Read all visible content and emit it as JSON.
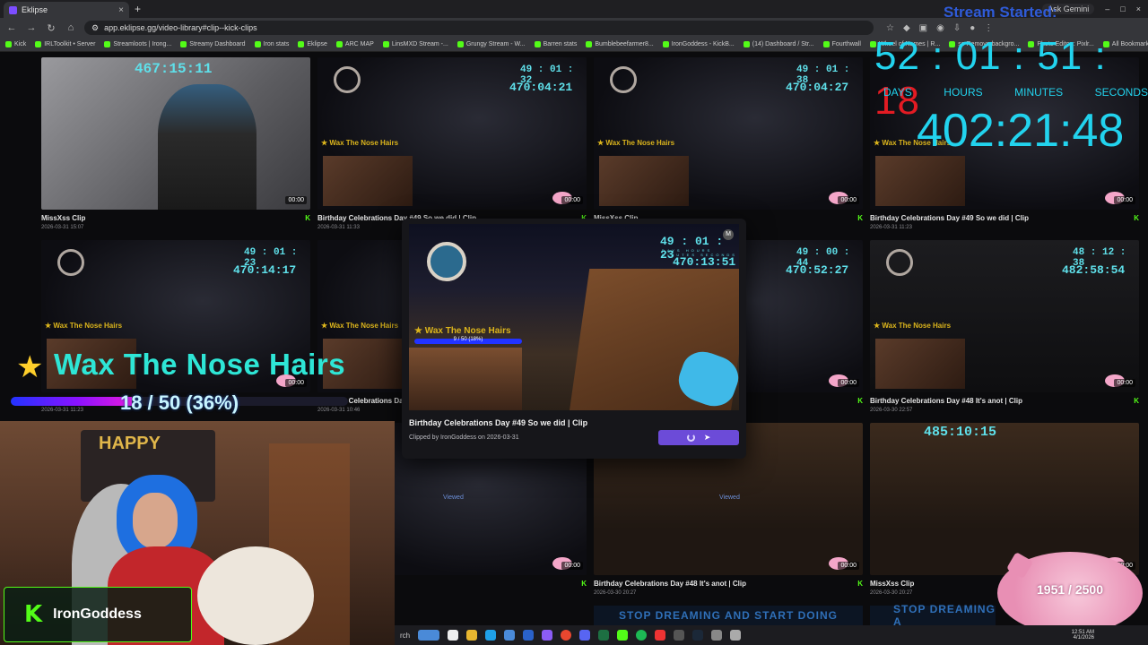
{
  "browser": {
    "tab_title": "Eklipse",
    "tab_close": "×",
    "new_tab": "+",
    "right_items": [
      "Ask Gemini",
      "–",
      "□",
      "×"
    ],
    "url": "app.eklipse.gg/video-library#clip--kick-clips",
    "bookmarks": [
      "Kick",
      "IRLToolkit • Server",
      "Streamloots | Irong...",
      "Streamy Dashboard",
      "Iron stats",
      "Eklipse",
      "ARC MAP",
      "LinsMXD Stream -...",
      "Grungy Stream - W...",
      "Barren stats",
      "Bumblebeefarmer8...",
      "IronGoddess - KickB...",
      "(14) Dashboard / Str...",
      "Fourthwall",
      "Wheel of Names | R...",
      "se Remove backgro...",
      "Photo Editor : Pixlr...",
      "All Bookmarks"
    ]
  },
  "stream_timer": {
    "label": "Stream Started:",
    "days": "52",
    "hours": "01",
    "minutes": "51",
    "seconds": "18",
    "sep": ":",
    "unit_days": "DAYS",
    "unit_hours": "HOURS",
    "unit_minutes": "MINUTES",
    "unit_seconds": "SECONDS",
    "total": "402:21:48"
  },
  "goal": {
    "star": "★",
    "title": "Wax The Nose Hairs",
    "progress_text": "18 / 50 (36%)",
    "fraction": 0.36
  },
  "streamer": {
    "kick_logo": "K",
    "name": "IronGoddess",
    "banner_text": "HAPPY"
  },
  "clips": [
    {
      "title": "MissXss Clip",
      "date": "2026-03-31 15:07",
      "timer": "467:15:11",
      "duration": "00:00"
    },
    {
      "title": "Birthday Celebrations Day #49 So we did | Clip",
      "date": "2026-03-31 11:33",
      "timer": "470:04:21",
      "timer_top": "49 : 01 : 32",
      "wax": "Wax The Nose Hairs",
      "duration": "00:00"
    },
    {
      "title": "MissXss Clip",
      "date": "",
      "timer": "470:04:27",
      "timer_top": "49 : 01 : 38",
      "wax": "Wax The Nose Hairs",
      "duration": "00:00"
    },
    {
      "title": "Birthday Celebrations Day #49 So we did | Clip",
      "date": "2026-03-31 11:23",
      "timer": "",
      "wax": "Wax The Nose Hairs",
      "duration": "00:00"
    },
    {
      "title": "",
      "date": "2026-03-31 11:23",
      "timer": "470:14:17",
      "timer_top": "49 : 01 : 23",
      "wax": "Wax The Nose Hairs",
      "duration": "00:00"
    },
    {
      "title": "Birthday Celebrations Day",
      "date": "2026-03-31 10:46",
      "timer": "",
      "wax": "Wax The Nose Hairs",
      "duration": "00:00"
    },
    {
      "title": "",
      "date": "",
      "timer": "470:52:27",
      "timer_top": "49 : 00 : 44",
      "duration": "00:00"
    },
    {
      "title": "Birthday Celebrations Day #48 It's anot | Clip",
      "date": "2026-03-30 22:57",
      "timer": "482:58:54",
      "timer_top": "48 : 12 : 38",
      "wax": "Wax The Nose Hairs",
      "duration": "00:00"
    },
    {
      "title": "",
      "date": "",
      "timer": "",
      "viewed": "Viewed",
      "duration": "00:00"
    },
    {
      "title": "Birthday Celebrations Day #48 It's anot | Clip",
      "date": "2026-03-30 20:27",
      "timer": "",
      "viewed": "Viewed",
      "duration": "00:00"
    },
    {
      "title": "MissXss Clip",
      "date": "2026-03-30 20:27",
      "timer": "485:10:15",
      "duration": "00:00"
    }
  ],
  "preview": {
    "timer_top": "49 : 01 : 23",
    "units": "DAYS HOURS MINUTES SECONDS",
    "timer": "470:13:51",
    "wax": "Wax The Nose Hairs",
    "wax_progress": "9 / 50 (18%)",
    "title": "Birthday Celebrations Day #49 So we did | Clip",
    "clipped_by": "Clipped by IronGoddess on 2026-03-31",
    "m_badge": "M"
  },
  "pig_goal": {
    "text": "1951 / 2500"
  },
  "banners": {
    "dream": "STOP DREAMING AND START DOING",
    "dream2": "STOP DREAMING A"
  },
  "taskbar": {
    "search": "rch",
    "time": "12:51 AM",
    "date": "4/1/2026"
  },
  "colors": {
    "accent_cyan": "#22d3ee",
    "kick_green": "#53fc18",
    "seconds_red": "#e31b23",
    "button_purple": "#6c4bd8"
  }
}
